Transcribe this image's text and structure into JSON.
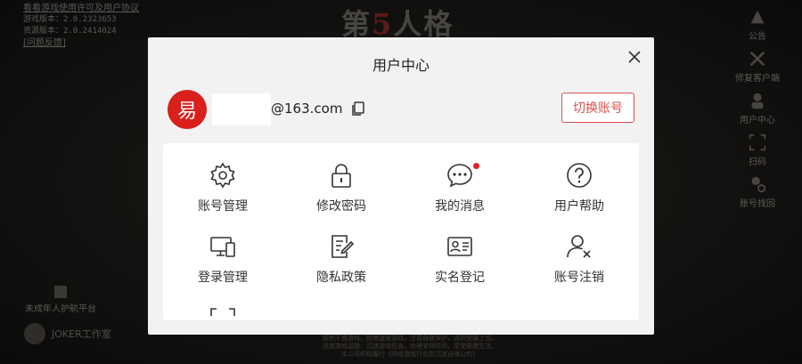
{
  "background": {
    "top_left": {
      "link": "看看游戏使用许可及用户协议",
      "version1": "游戏版本：2.0.2323653",
      "version2": "资源版本：2.0.2414024",
      "feedback": "[问题反馈]"
    },
    "logo": {
      "pre": "第",
      "five": "5",
      "post": "人格"
    },
    "right_menu": [
      {
        "label": "公告",
        "icon": "announcement-icon"
      },
      {
        "label": "修复客户端",
        "icon": "repair-tools-icon"
      },
      {
        "label": "用户中心",
        "icon": "user-center-icon"
      },
      {
        "label": "扫码",
        "icon": "scan-icon"
      },
      {
        "label": "账号找回",
        "icon": "account-recovery-icon"
      }
    ],
    "minor_platform": "未成年人护航平台",
    "studio": "JOKER工作室",
    "footer_lines": [
      "抵制不良游戏，拒绝盗版游戏。注意自我保护，谨防受骗上当。",
      "适度游戏益脑，沉迷游戏伤身。合理安排时间，享受健康生活。",
      "本公司积极履行《网络游戏行业防沉迷自律公约》"
    ]
  },
  "dialog": {
    "title": "用户中心",
    "account": {
      "avatar_char": "易",
      "email_suffix": "@163.com",
      "switch_label": "切换账号"
    },
    "grid": [
      {
        "label": "账号管理",
        "icon": "gear-icon"
      },
      {
        "label": "修改密码",
        "icon": "lock-icon"
      },
      {
        "label": "我的消息",
        "icon": "message-icon",
        "badge": true
      },
      {
        "label": "用户帮助",
        "icon": "help-icon"
      },
      {
        "label": "登录管理",
        "icon": "devices-icon"
      },
      {
        "label": "隐私政策",
        "icon": "privacy-policy-icon"
      },
      {
        "label": "实名登记",
        "icon": "id-card-icon"
      },
      {
        "label": "账号注销",
        "icon": "user-remove-icon"
      }
    ]
  },
  "colors": {
    "accent": "#d9534f",
    "avatar": "#d9201c",
    "badge": "#e02020"
  }
}
